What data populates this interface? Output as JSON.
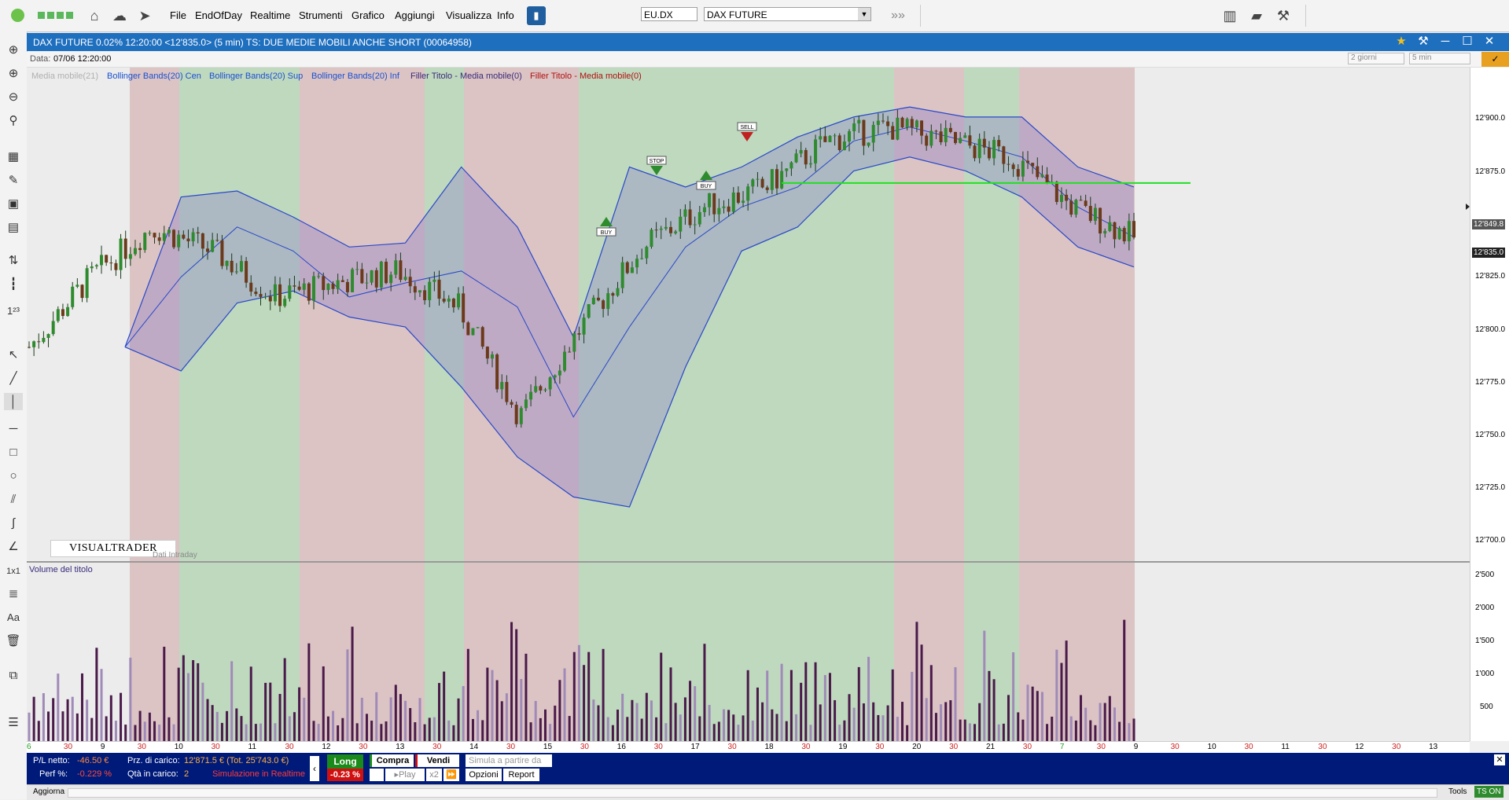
{
  "menu": [
    "File",
    "EndOfDay",
    "Realtime",
    "Strumenti",
    "Grafico",
    "Aggiungi",
    "Visualizza",
    "Info"
  ],
  "search": {
    "symbol": "EU.DX",
    "name": "DAX FUTURE"
  },
  "window": {
    "title": "DAX FUTURE 0.02% 12:20:00  <12'835.0> (5 min) TS: DUE MEDIE MOBILI ANCHE SHORT (00064958)"
  },
  "info": {
    "data_label": "Data:",
    "data_value": "07/06 12:20:00",
    "range": "2 giorni",
    "interval": "5 min"
  },
  "legend": [
    {
      "label": "Media mobile(21)",
      "color": "#b0b0b0"
    },
    {
      "label": "Bollinger Bands(20) Cen",
      "color": "#1a4fd0"
    },
    {
      "label": "Bollinger Bands(20) Sup",
      "color": "#1a4fd0"
    },
    {
      "label": "Bollinger Bands(20) Inf",
      "color": "#1a4fd0"
    },
    {
      "label": "Filler Titolo - Media mobile(0)",
      "color": "#3a2a7a"
    },
    {
      "label": "Filler Titolo - Media mobile(0)",
      "color": "#b01010"
    }
  ],
  "price_axis": [
    "12'900.0",
    "12'875.0",
    "12'849.8",
    "12'835.0",
    "12'825.0",
    "12'800.0",
    "12'775.0",
    "12'750.0",
    "12'725.0",
    "12'700.0"
  ],
  "volume_axis": [
    "2'500",
    "2'000",
    "1'500",
    "1'000",
    "500"
  ],
  "volume_label": "Volume del titolo",
  "brand": "VISUALTRADER",
  "dati": "Dati Intraday",
  "x_labels": [
    "6",
    "30",
    "9",
    "30",
    "10",
    "30",
    "11",
    "30",
    "12",
    "30",
    "13",
    "30",
    "14",
    "30",
    "15",
    "30",
    "16",
    "30",
    "17",
    "30",
    "18",
    "30",
    "19",
    "30",
    "20",
    "30",
    "21",
    "30",
    "7",
    "30",
    "9",
    "30",
    "10",
    "30",
    "11",
    "30",
    "12",
    "30",
    "13"
  ],
  "markers": {
    "buy": "BUY",
    "sell": "SELL",
    "stop": "STOP"
  },
  "bottom": {
    "pl_label": "P/L netto:",
    "pl_value": "-46.50 €",
    "perf_label": "Perf %:",
    "perf_value": "-0.229 %",
    "prz_label": "Prz. di carico:",
    "prz_value": "12'871.5 € (Tot. 25'743.0 €)",
    "qta_label": "Qtà in carico:",
    "qta_value": "2",
    "sim": "Simulazione in Realtime",
    "long": "Long",
    "long_pct": "-0.23 %",
    "compra": "Compra",
    "vendi": "Vendi",
    "play": "Play",
    "x2": "x2",
    "simula_placeholder": "Simula a partire da",
    "opzioni": "Opzioni",
    "report": "Report"
  },
  "status": {
    "aggiorna": "Aggiorna",
    "tools": "Tools",
    "ts_on": "TS ON"
  },
  "chart_data": {
    "type": "line",
    "title": "DAX FUTURE (5 min)",
    "ylim": [
      12690,
      12925
    ],
    "x": [
      "6",
      "9",
      "10",
      "11",
      "12",
      "13",
      "14",
      "15",
      "16",
      "17",
      "18",
      "19",
      "20",
      "21",
      "7",
      "9",
      "10",
      "11",
      "12"
    ],
    "series": [
      {
        "name": "Bollinger Bands(20) Sup",
        "values": [
          12790,
          12865,
          12868,
          12855,
          12840,
          12842,
          12880,
          12850,
          12795,
          12880,
          12870,
          12880,
          12895,
          12905,
          12910,
          12905,
          12905,
          12880,
          12870
        ]
      },
      {
        "name": "Bollinger Bands(20) Cen",
        "values": [
          12790,
          12825,
          12850,
          12838,
          12815,
          12822,
          12828,
          12810,
          12755,
          12800,
          12840,
          12860,
          12870,
          12893,
          12900,
          12893,
          12885,
          12860,
          12845
        ]
      },
      {
        "name": "Bollinger Bands(20) Inf",
        "values": [
          12790,
          12778,
          12812,
          12818,
          12805,
          12800,
          12770,
          12735,
          12715,
          12710,
          12780,
          12838,
          12850,
          12878,
          12885,
          12878,
          12865,
          12840,
          12830
        ]
      }
    ]
  }
}
